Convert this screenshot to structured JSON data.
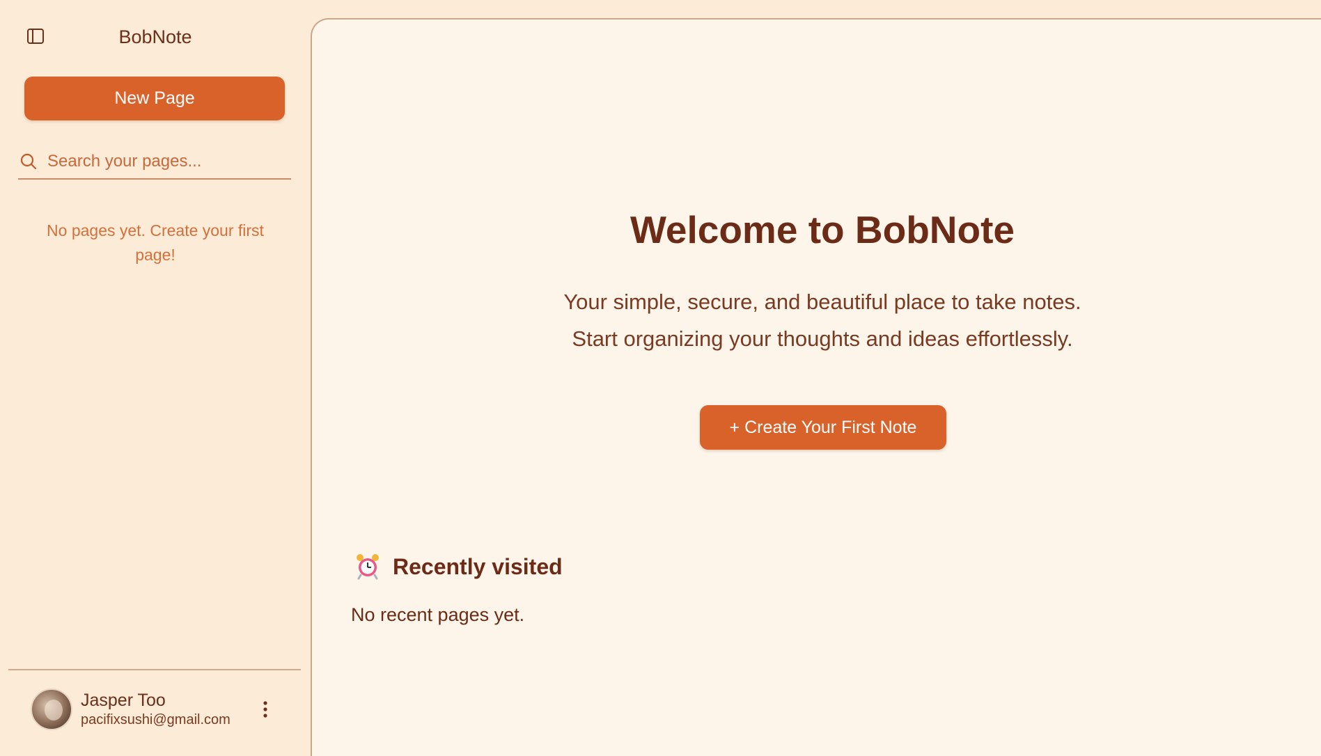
{
  "sidebar": {
    "app_title": "BobNote",
    "new_page_label": "New Page",
    "search_placeholder": "Search your pages...",
    "empty_message": "No pages yet. Create your first page!",
    "toggle_icon": "sidebar-toggle-icon",
    "user": {
      "name": "Jasper Too",
      "email": "pacifixsushi@gmail.com"
    }
  },
  "main": {
    "title": "Welcome to BobNote",
    "subtitle_line1": "Your simple, secure, and beautiful place to take notes.",
    "subtitle_line2": "Start organizing your thoughts and ideas effortlessly.",
    "create_label": "+ Create Your First Note",
    "recent": {
      "title": "Recently visited",
      "empty": "No recent pages yet."
    }
  },
  "colors": {
    "accent": "#d9622b",
    "sidebar_bg": "#fcebd6",
    "main_bg": "#fdf5ea",
    "text_dark": "#6b2b17"
  }
}
